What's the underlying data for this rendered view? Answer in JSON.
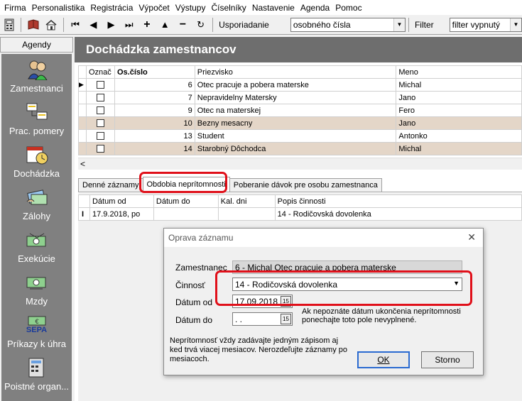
{
  "menu": [
    "Firma",
    "Personalistika",
    "Registrácia",
    "Výpočet",
    "Výstupy",
    "Číselníky",
    "Nastavenie",
    "Agenda",
    "Pomoc"
  ],
  "toolbar": {
    "sort_label": "Usporiadanie",
    "sort_value": "osobného čísla",
    "filter_label": "Filter",
    "filter_value": "filter vypnutý"
  },
  "sidebar": {
    "header": "Agendy",
    "items": [
      {
        "label": "Zamestnanci",
        "icon": "employees-icon"
      },
      {
        "label": "Prac. pomery",
        "icon": "work-relations-icon"
      },
      {
        "label": "Dochádzka",
        "icon": "attendance-icon"
      },
      {
        "label": "Zálohy",
        "icon": "advances-icon"
      },
      {
        "label": "Exekúcie",
        "icon": "executions-icon"
      },
      {
        "label": "Mzdy",
        "icon": "wages-icon"
      },
      {
        "label": "Príkazy k úhra",
        "icon": "sepa-icon",
        "icon_text": "SEPA"
      },
      {
        "label": "Poistné organ...",
        "icon": "insurance-icon"
      }
    ]
  },
  "main": {
    "title": "Dochádzka zamestnancov",
    "columns": [
      "Označ",
      "Os.číslo",
      "Priezvisko",
      "Meno"
    ],
    "rows": [
      {
        "id": "6",
        "surname": "Otec pracuje a pobera materske",
        "name": "Michal",
        "current": true,
        "highlight": false
      },
      {
        "id": "7",
        "surname": "Nepravidelny Matersky",
        "name": "Jano",
        "current": false,
        "highlight": false
      },
      {
        "id": "9",
        "surname": "Otec na materskej",
        "name": "Fero",
        "current": false,
        "highlight": false
      },
      {
        "id": "10",
        "surname": "Bezny mesacny",
        "name": "Jano",
        "current": false,
        "highlight": true
      },
      {
        "id": "13",
        "surname": "Student",
        "name": "Antonko",
        "current": false,
        "highlight": false
      },
      {
        "id": "14",
        "surname": "Starobný Dôchodca",
        "name": "Michal",
        "current": false,
        "highlight": true
      }
    ],
    "tabs": [
      {
        "label": "Denné záznamy",
        "active": false
      },
      {
        "label": "Obdobia neprítomnosti",
        "active": true
      },
      {
        "label": "Poberanie dávok pre osobu zamestnanca",
        "active": false
      }
    ],
    "detail_columns": [
      "Dátum od",
      "Dátum do",
      "Kal. dni",
      "Popis činnosti"
    ],
    "detail_rows": [
      {
        "from": "17.9.2018, po",
        "to": "",
        "days": "",
        "desc": "14 - Rodičovská dovolenka"
      }
    ]
  },
  "dialog": {
    "title": "Oprava záznamu",
    "employee_label": "Zamestnanec",
    "employee_value": "6 - Michal Otec pracuje a pobera materske",
    "activity_label": "Činnosť",
    "activity_value": "14 - Rodičovská dovolenka",
    "date_from_label": "Dátum od",
    "date_from_value": "17.09.2018",
    "date_to_label": "Dátum do",
    "date_to_value": " .  .",
    "date_to_hint": "Ak nepoznáte dátum ukončenia neprítomnosti ponechajte toto pole nevyplnené.",
    "note": "Neprítomnosť vždy zadávajte jedným zápisom aj ked trvá viacej mesiacov. Nerozdeľujte záznamy po mesiacoch.",
    "ok_label": "OK",
    "cancel_label": "Storno"
  },
  "colors": {
    "highlight_red": "#e0101a",
    "row_highlight": "#e4d6c8",
    "title_bar": "#6e6e6e",
    "sidebar_bg": "#808080"
  }
}
